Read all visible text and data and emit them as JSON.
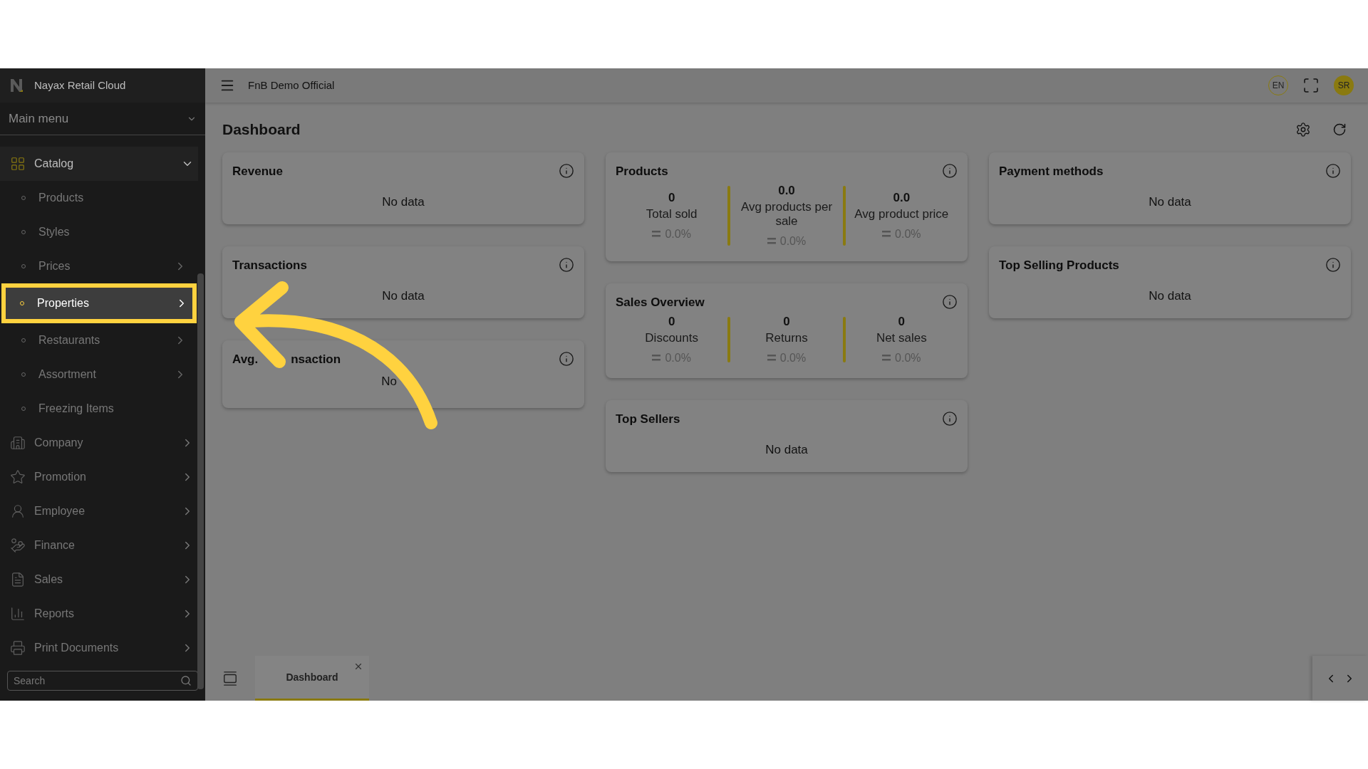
{
  "sidebar": {
    "brand": "Nayax Retail Cloud",
    "main_menu": "Main menu",
    "items": [
      {
        "label": "Catalog",
        "expanded": true,
        "children": [
          {
            "label": "Products",
            "selected": false,
            "has_submenu": false
          },
          {
            "label": "Styles",
            "selected": false,
            "has_submenu": false
          },
          {
            "label": "Prices",
            "selected": false,
            "has_submenu": true
          },
          {
            "label": "Properties",
            "selected": true,
            "has_submenu": true
          },
          {
            "label": "Restaurants",
            "selected": false,
            "has_submenu": true
          },
          {
            "label": "Assortment",
            "selected": false,
            "has_submenu": true
          },
          {
            "label": "Freezing Items",
            "selected": false,
            "has_submenu": false
          }
        ]
      },
      {
        "label": "Company",
        "expanded": false
      },
      {
        "label": "Promotion",
        "expanded": false
      },
      {
        "label": "Employee",
        "expanded": false
      },
      {
        "label": "Finance",
        "expanded": false
      },
      {
        "label": "Sales",
        "expanded": false
      },
      {
        "label": "Reports",
        "expanded": false
      },
      {
        "label": "Print Documents",
        "expanded": false
      }
    ],
    "search": {
      "placeholder": "Search"
    }
  },
  "topbar": {
    "title": "FnB Demo Official",
    "language": "EN",
    "avatar": "SR"
  },
  "page": {
    "title": "Dashboard"
  },
  "columns": [
    [
      {
        "kind": "empty",
        "title": "Revenue",
        "message": "No data"
      },
      {
        "kind": "empty",
        "title": "Transactions",
        "message": "No data"
      },
      {
        "kind": "partial",
        "title_parts": [
          "Avg.",
          "nsaction"
        ],
        "message_parts": [
          "No"
        ]
      }
    ],
    [
      {
        "kind": "stats",
        "title": "Products",
        "stats": [
          {
            "value": "0",
            "label": "Total sold",
            "change": "0.0%"
          },
          {
            "value": "0.0",
            "label": "Avg products per sale",
            "change": "0.0%"
          },
          {
            "value": "0.0",
            "label": "Avg product price",
            "change": "0.0%"
          }
        ]
      },
      {
        "kind": "stats",
        "title": "Sales Overview",
        "stats": [
          {
            "value": "0",
            "label": "Discounts",
            "change": "0.0%"
          },
          {
            "value": "0",
            "label": "Returns",
            "change": "0.0%"
          },
          {
            "value": "0",
            "label": "Net sales",
            "change": "0.0%"
          }
        ]
      },
      {
        "kind": "empty",
        "title": "Top Sellers",
        "message": "No data"
      }
    ],
    [
      {
        "kind": "empty",
        "title": "Payment methods",
        "message": "No data"
      },
      {
        "kind": "empty",
        "title": "Top Selling Products",
        "message": "No data"
      }
    ]
  ],
  "bottom_tabs": [
    {
      "label": "Dashboard",
      "selected": true
    }
  ]
}
